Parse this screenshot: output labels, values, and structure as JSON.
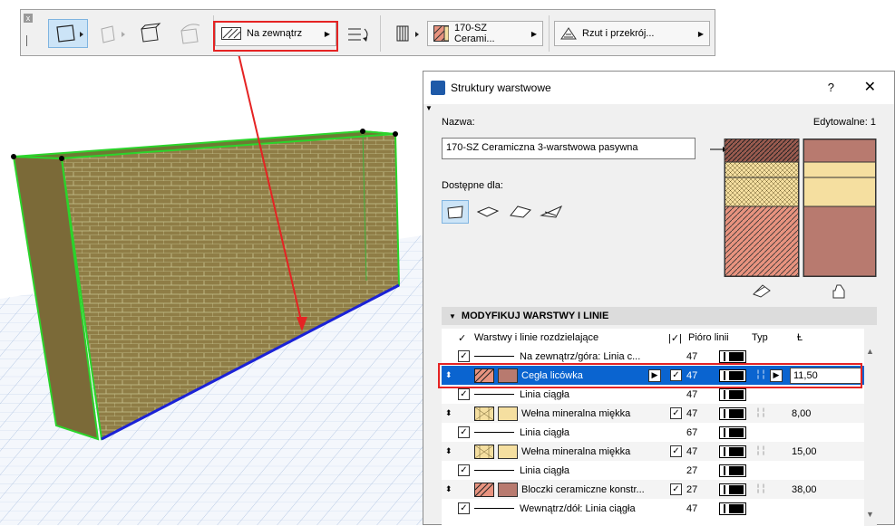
{
  "toolbar": {
    "close_glyph": "x",
    "edge_combo_label": "Na zewnątrz",
    "structure_combo_label": "170-SZ Cerami...",
    "view_combo_label": "Rzut i przekrój...",
    "icons": [
      "geometry-straight-wall-icon",
      "geometry-trapezoid-icon",
      "geometry-slanted-icon",
      "geometry-double-slanted-icon",
      "flip-direction-icon",
      "structure-type-icon",
      "composite-swatch-icon",
      "floor-plan-icon"
    ]
  },
  "dialog": {
    "title": "Struktury warstwowe",
    "help": "?",
    "close": "✕",
    "name_label": "Nazwa:",
    "editable_label": "Edytowalne: 1",
    "name_value": "170-SZ Ceramiczna 3-warstwowa pasywna",
    "available_label": "Dostępne dla:",
    "available_for": [
      "wall-icon",
      "slab-icon",
      "roof-icon",
      "shell-icon"
    ],
    "section_title": "MODYFIKUJ WARSTWY I LINIE",
    "columns": {
      "check": "✓",
      "layers": "Warstwy i linie rozdzielające",
      "pen_check": "|✓|",
      "pen": "Pióro linii",
      "type": "Typ",
      "thickness_icon": "Ⱡ"
    },
    "rows": [
      {
        "kind": "line",
        "checked": true,
        "name": "Na zewnątrz/góra: Linia c...",
        "pen": "47"
      },
      {
        "kind": "layer",
        "selected": true,
        "name": "Cegła licówka",
        "pen": "47",
        "thickness": "11,50",
        "color": "#b87a6f",
        "hatch": "brick"
      },
      {
        "kind": "line",
        "checked": true,
        "name": "Linia ciągła",
        "pen": "47"
      },
      {
        "kind": "layer",
        "name": "Wełna mineralna miękka",
        "pen": "47",
        "thickness": "8,00",
        "color": "#f5dfa0",
        "hatch": "insulation"
      },
      {
        "kind": "line",
        "checked": true,
        "name": "Linia ciągła",
        "pen": "67"
      },
      {
        "kind": "layer",
        "name": "Wełna mineralna miękka",
        "pen": "47",
        "thickness": "15,00",
        "color": "#f5dfa0",
        "hatch": "insulation"
      },
      {
        "kind": "line",
        "checked": true,
        "name": "Linia ciągła",
        "pen": "27"
      },
      {
        "kind": "layer",
        "name": "Bloczki ceramiczne konstr...",
        "pen": "27",
        "thickness": "38,00",
        "color": "#b87a6f",
        "hatch": "brick"
      },
      {
        "kind": "line",
        "checked": true,
        "name": "Wewnątrz/dół: Linia ciągła",
        "pen": "47"
      }
    ],
    "colors": {
      "brick": "#b87a6f",
      "brick_hatch": "#e8937f",
      "insulation": "#f5dfa0",
      "selection": "#0a64d0",
      "highlight": "#e52323"
    }
  },
  "viewport": {
    "wall_color": "#8a7a45",
    "grid_color": "#9bb4dc",
    "outline_color": "#2bd42b",
    "base_line_color": "#1b22d6"
  }
}
